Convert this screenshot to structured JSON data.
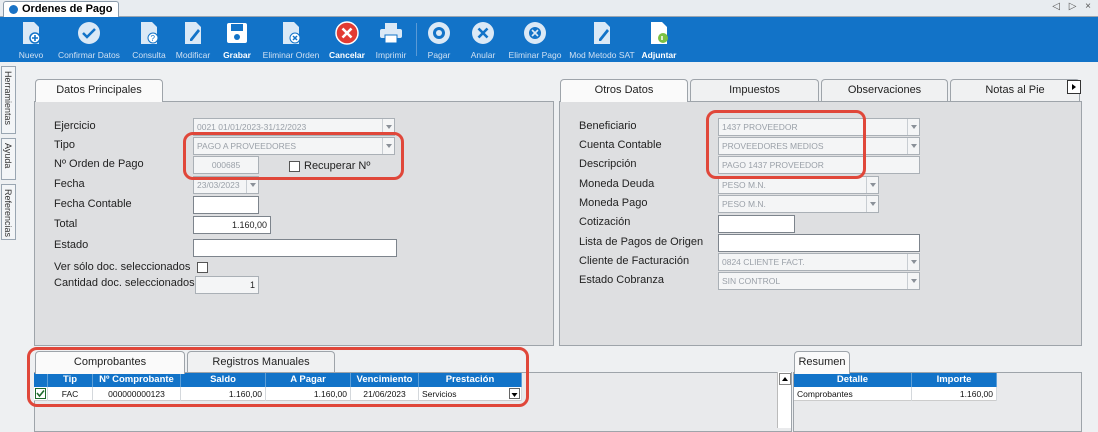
{
  "window": {
    "title": "Ordenes de Pago",
    "nav_arrows": "◁ ▷ ×"
  },
  "toolbar": [
    {
      "label": "Nuevo",
      "icon": "new-doc-icon"
    },
    {
      "label": "Confirmar Datos",
      "icon": "check-circle-icon"
    },
    {
      "label": "Consulta",
      "icon": "query-doc-icon"
    },
    {
      "label": "Modificar",
      "icon": "edit-doc-icon"
    },
    {
      "label": "Grabar",
      "icon": "save-icon"
    },
    {
      "label": "Eliminar Orden",
      "icon": "delete-doc-icon"
    },
    {
      "label": "Cancelar",
      "icon": "cancel-icon"
    },
    {
      "label": "Imprimir",
      "icon": "print-icon"
    },
    {
      "label": "Pagar",
      "icon": "pay-icon"
    },
    {
      "label": "Anular",
      "icon": "annul-icon"
    },
    {
      "label": "Eliminar Pago",
      "icon": "delete-payment-icon"
    },
    {
      "label": "Mod Metodo SAT",
      "icon": "edit-sat-icon"
    },
    {
      "label": "Adjuntar",
      "icon": "attach-icon"
    }
  ],
  "side_tabs": [
    "Herramientas",
    "Ayuda",
    "Referencias"
  ],
  "principal": {
    "tab": "Datos Principales",
    "ejercicio_label": "Ejercicio",
    "ejercicio_value": "0021 01/01/2023-31/12/2023",
    "tipo_label": "Tipo",
    "tipo_value": "PAGO A PROVEEDORES",
    "orden_label": "Nº Orden de Pago",
    "orden_value": "000685",
    "recuperar_label": "Recuperar Nº",
    "fecha_label": "Fecha",
    "fecha_value": "23/03/2023",
    "fecha_contable_label": "Fecha Contable",
    "fecha_contable_value": "",
    "total_label": "Total",
    "total_value": "1.160,00",
    "estado_label": "Estado",
    "estado_value": "",
    "ver_label": "Ver sólo doc. seleccionados",
    "cantidad_label": "Cantidad doc. seleccionados",
    "cantidad_value": "1"
  },
  "otros": {
    "tabs": [
      "Otros Datos",
      "Impuestos",
      "Observaciones",
      "Notas al Pie"
    ],
    "beneficiario_label": "Beneficiario",
    "beneficiario_value": "1437 PROVEEDOR",
    "cuenta_label": "Cuenta Contable",
    "cuenta_value": "PROVEEDORES MEDIOS",
    "descripcion_label": "Descripción",
    "descripcion_value": "PAGO 1437 PROVEEDOR",
    "moneda_deuda_label": "Moneda Deuda",
    "moneda_deuda_value": "PESO M.N.",
    "moneda_pago_label": "Moneda Pago",
    "moneda_pago_value": "PESO M.N.",
    "cotizacion_label": "Cotización",
    "cotizacion_value": "",
    "lista_label": "Lista de Pagos de Origen",
    "lista_value": "",
    "cliente_label": "Cliente de Facturación",
    "cliente_value": "0824 CLIENTE FACT.",
    "estado_cobranza_label": "Estado Cobranza",
    "estado_cobranza_value": "SIN CONTROL"
  },
  "comprobantes": {
    "tabs": [
      "Comprobantes",
      "Registros Manuales"
    ],
    "headers": [
      "Tip",
      "Nº Comprobante",
      "Saldo",
      "A Pagar",
      "Vencimiento",
      "Prestación"
    ],
    "rows": [
      {
        "tip": "FAC",
        "numero": "000000000123",
        "saldo": "1.160,00",
        "a_pagar": "1.160,00",
        "vencimiento": "21/06/2023",
        "prestacion": "Servicios"
      }
    ]
  },
  "resumen": {
    "tab": "Resumen",
    "headers": [
      "Detalle",
      "Importe"
    ],
    "rows": [
      {
        "detalle": "Comprobantes",
        "importe": "1.160,00"
      }
    ]
  },
  "colors": {
    "accent": "#1273c8",
    "highlight": "#e0473a"
  }
}
